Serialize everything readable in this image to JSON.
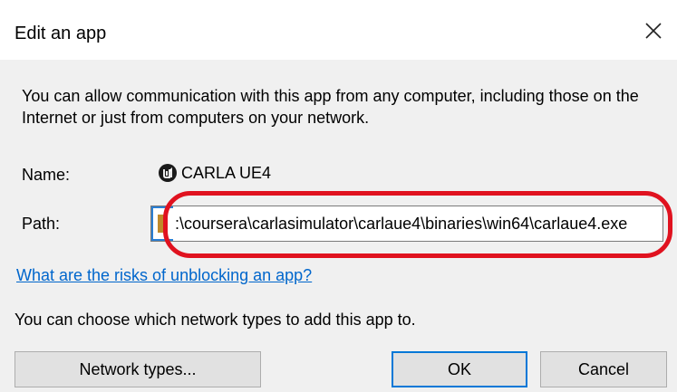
{
  "window": {
    "title": "Edit an app",
    "close_glyph": "✕"
  },
  "description": "You can allow communication with this app from any computer, including those on the Internet or just from computers on your network.",
  "fields": {
    "name_label": "Name:",
    "app_name": "CARLA UE4",
    "app_icon": "unreal-engine-icon",
    "path_label": "Path:",
    "path_value": ":\\coursera\\carlasimulator\\carlaue4\\binaries\\win64\\carlaue4.exe"
  },
  "link": {
    "text": "What are the risks of unblocking an app?"
  },
  "network_text": "You can choose which network types to add this app to.",
  "buttons": {
    "network_types": "Network types...",
    "ok": "OK",
    "cancel": "Cancel"
  },
  "colors": {
    "annotation": "#e0121f",
    "link": "#0066cc",
    "focus": "#0078d7"
  }
}
